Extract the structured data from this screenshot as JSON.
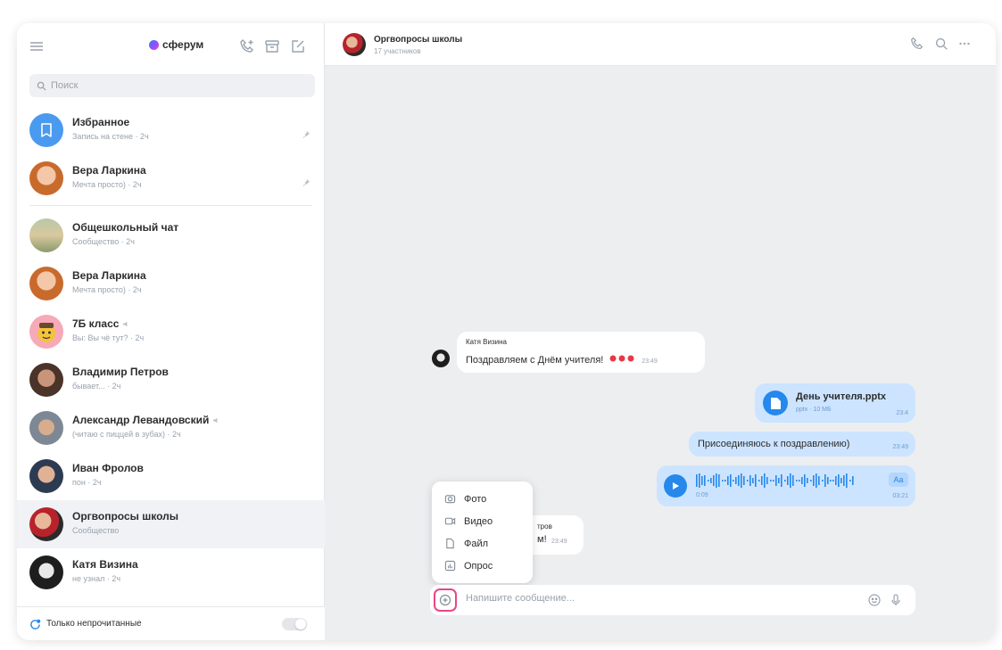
{
  "app": {
    "logo_text": "сферум"
  },
  "search": {
    "placeholder": "Поиск"
  },
  "chats": [
    {
      "name": "Избранное",
      "sub": "Запись на стене · 2ч",
      "pinned": true
    },
    {
      "name": "Вера Ларкина",
      "sub": "Мечта просто) · 2ч",
      "pinned": true
    },
    {
      "name": "Общешкольный чат",
      "sub": "Сообщество · 2ч"
    },
    {
      "name": "Вера Ларкина",
      "sub": "Мечта просто) · 2ч"
    },
    {
      "name": "7Б класс",
      "sub": "Вы: Вы чё тут? · 2ч",
      "muted": true
    },
    {
      "name": "Владимир Петров",
      "sub": "бывает... · 2ч"
    },
    {
      "name": "Александр Левандовский",
      "sub": "(читаю с пиццей в зубах) · 2ч",
      "muted": true
    },
    {
      "name": "Иван Фролов",
      "sub": "пон · 2ч"
    },
    {
      "name": "Оргвопросы школы",
      "sub": "Сообщество",
      "active": true
    },
    {
      "name": "Катя Визина",
      "sub": "не узнал · 2ч"
    }
  ],
  "sidebar_bottom": {
    "unread_label": "Только непрочитанные"
  },
  "header": {
    "title": "Оргвопросы школы",
    "subtitle": "17 участников"
  },
  "messages": {
    "m1": {
      "sender": "Катя Визина",
      "text": "Поздравляем с Днём учителя!",
      "time": "23:49"
    },
    "m2": {
      "file_name": "День учителя.pptx",
      "file_meta": "pptx · 10 МБ",
      "time": "23:4"
    },
    "m3": {
      "text": "Присоединяюсь к поздравлению)",
      "time": "23:49"
    },
    "m4": {
      "duration": "0:09",
      "time": "03:21",
      "transcribe_label": "Aa"
    },
    "m5": {
      "sender_fragment": "тров",
      "text_fragment": "м!",
      "time": "23:49"
    }
  },
  "attach_menu": [
    {
      "label": "Фото",
      "icon": "camera-icon"
    },
    {
      "label": "Видео",
      "icon": "video-icon"
    },
    {
      "label": "Файл",
      "icon": "file-icon"
    },
    {
      "label": "Опрос",
      "icon": "poll-icon"
    }
  ],
  "composer": {
    "placeholder": "Напишите сообщение..."
  },
  "colors": {
    "accent": "#2688eb",
    "outgoing_bubble": "#cce4ff",
    "highlight": "#e64788"
  }
}
